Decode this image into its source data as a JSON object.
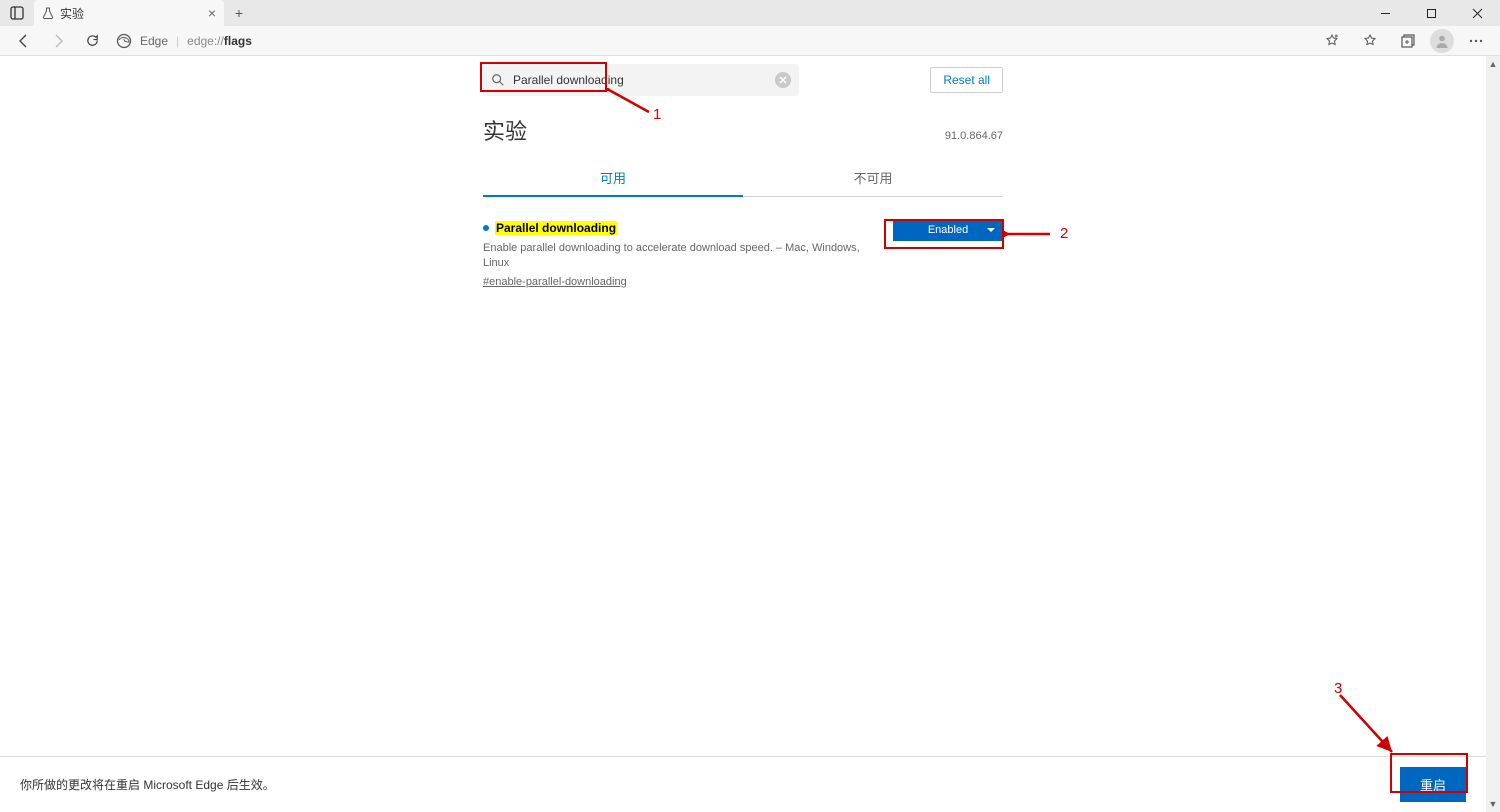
{
  "tab": {
    "title": "实验"
  },
  "address": {
    "engine": "Edge",
    "url_prefix": "edge://",
    "url_path": "flags"
  },
  "search": {
    "value": "Parallel downloading"
  },
  "reset_label": "Reset all",
  "page_title": "实验",
  "version": "91.0.864.67",
  "tabs": {
    "available": "可用",
    "unavailable": "不可用"
  },
  "flag": {
    "name": "Parallel downloading",
    "description": "Enable parallel downloading to accelerate download speed. – Mac, Windows, Linux",
    "anchor": "#enable-parallel-downloading",
    "selected": "Enabled"
  },
  "bottom": {
    "message": "你所做的更改将在重启 Microsoft Edge 后生效。",
    "restart": "重启"
  },
  "annotations": {
    "l1": "1",
    "l2": "2",
    "l3": "3"
  }
}
